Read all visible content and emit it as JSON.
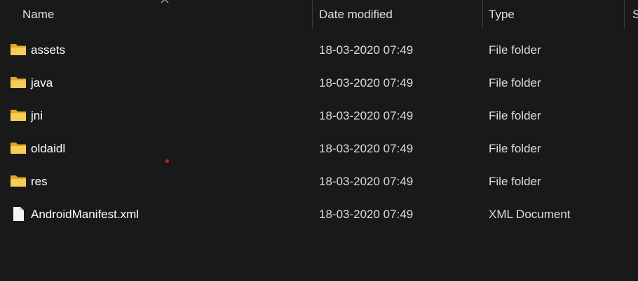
{
  "columns": {
    "name": "Name",
    "date": "Date modified",
    "type": "Type",
    "size": "S"
  },
  "sort": {
    "column": "name",
    "direction": "ascending"
  },
  "files": [
    {
      "name": "assets",
      "date": "18-03-2020 07:49",
      "type": "File folder",
      "icon": "folder-icon"
    },
    {
      "name": "java",
      "date": "18-03-2020 07:49",
      "type": "File folder",
      "icon": "folder-icon"
    },
    {
      "name": "jni",
      "date": "18-03-2020 07:49",
      "type": "File folder",
      "icon": "folder-icon"
    },
    {
      "name": "oldaidl",
      "date": "18-03-2020 07:49",
      "type": "File folder",
      "icon": "folder-icon"
    },
    {
      "name": "res",
      "date": "18-03-2020 07:49",
      "type": "File folder",
      "icon": "folder-icon"
    },
    {
      "name": "AndroidManifest.xml",
      "date": "18-03-2020 07:49",
      "type": "XML Document",
      "icon": "file-icon"
    }
  ],
  "colors": {
    "background": "#191919",
    "folder": "#f5c342",
    "marker": "#d11a1a"
  }
}
